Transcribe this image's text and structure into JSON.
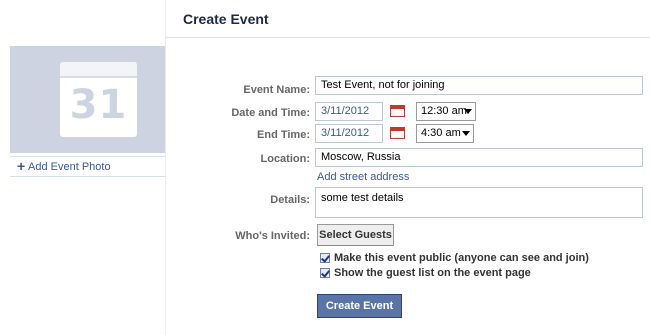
{
  "header": {
    "title": "Create Event"
  },
  "sidebar": {
    "calendar_day": "31",
    "add_photo_label": "Add Event Photo",
    "add_photo_icon": "plus-icon"
  },
  "form": {
    "event_name": {
      "label": "Event Name:",
      "value": "Test Event, not for joining"
    },
    "date_time": {
      "label": "Date and Time:",
      "date": "3/11/2012",
      "time": "12:30 am"
    },
    "end_time": {
      "label": "End Time:",
      "date": "3/11/2012",
      "time": "4:30 am"
    },
    "location": {
      "label": "Location:",
      "value": "Moscow, Russia",
      "add_street_link": "Add street address"
    },
    "details": {
      "label": "Details:",
      "value": "some test details"
    },
    "invited": {
      "label": "Who's Invited:",
      "button": "Select Guests"
    },
    "options": [
      {
        "label": "Make this event public (anyone can see and join)",
        "checked": true
      },
      {
        "label": "Show the guest list on the event page",
        "checked": true
      }
    ],
    "submit_label": "Create Event"
  },
  "colors": {
    "link": "#3b5998",
    "primary_button": "#5b74a8",
    "photo_placeholder": "#ced3e2"
  }
}
